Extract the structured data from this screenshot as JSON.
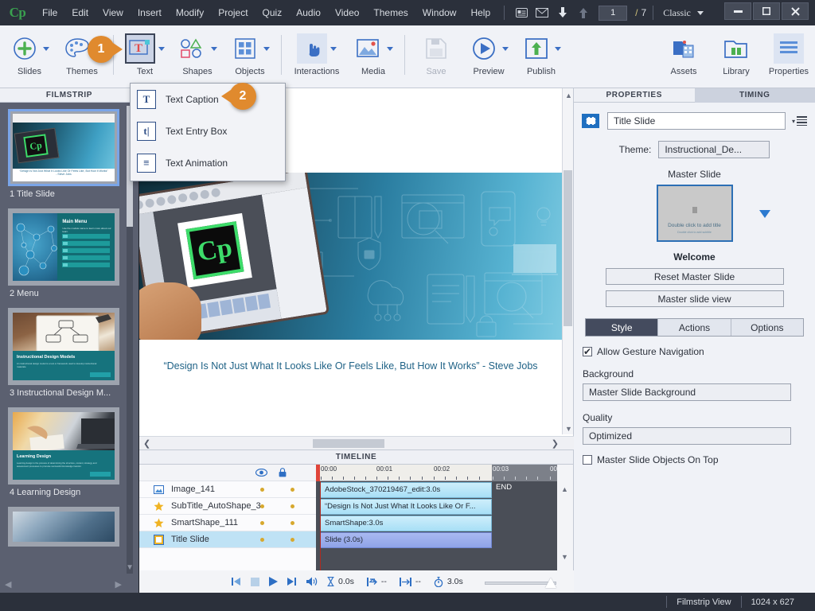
{
  "app": {
    "logo": "Cp",
    "title": "Adobe Captivate"
  },
  "menubar": {
    "items": [
      "File",
      "Edit",
      "View",
      "Insert",
      "Modify",
      "Project",
      "Quiz",
      "Audio",
      "Video",
      "Themes",
      "Window",
      "Help"
    ],
    "icons": [
      "notes-icon",
      "mail-icon",
      "download-arrow-icon",
      "upload-arrow-icon"
    ],
    "page_current": "1",
    "page_slash": "/",
    "page_total": "7",
    "workspace": "Classic",
    "window_buttons": {
      "minimize": "—",
      "maximize": "❐",
      "close": "✕"
    }
  },
  "toolbar": {
    "items": [
      {
        "label": "Slides",
        "icon": "add-slide-icon",
        "has_arrow": true,
        "state": "normal"
      },
      {
        "label": "Themes",
        "icon": "themes-palette-icon",
        "has_arrow": true,
        "state": "normal"
      },
      {
        "label": "Text",
        "icon": "text-tool-icon",
        "has_arrow": true,
        "state": "selected"
      },
      {
        "label": "Shapes",
        "icon": "shapes-icon",
        "has_arrow": true,
        "state": "normal"
      },
      {
        "label": "Objects",
        "icon": "objects-grid-icon",
        "has_arrow": true,
        "state": "normal"
      },
      {
        "label": "Interactions",
        "icon": "interactions-hand-icon",
        "has_arrow": true,
        "state": "highlight"
      },
      {
        "label": "Media",
        "icon": "media-image-icon",
        "has_arrow": true,
        "state": "normal"
      },
      {
        "label": "Save",
        "icon": "save-floppy-icon",
        "has_arrow": false,
        "state": "disabled"
      },
      {
        "label": "Preview",
        "icon": "preview-play-icon",
        "has_arrow": true,
        "state": "normal"
      },
      {
        "label": "Publish",
        "icon": "publish-upload-icon",
        "has_arrow": true,
        "state": "normal"
      },
      {
        "label": "Assets",
        "icon": "assets-icon",
        "has_arrow": false,
        "state": "normal"
      },
      {
        "label": "Library",
        "icon": "library-folder-icon",
        "has_arrow": false,
        "state": "normal"
      },
      {
        "label": "Properties",
        "icon": "properties-lines-icon",
        "has_arrow": false,
        "state": "highlight"
      }
    ]
  },
  "callouts": [
    {
      "number": "1",
      "target": "text-tool-button"
    },
    {
      "number": "2",
      "target": "text-caption-menu-item"
    }
  ],
  "text_menu": {
    "items": [
      {
        "label": "Text Caption",
        "icon": "text-caption-icon",
        "glyph": "T"
      },
      {
        "label": "Text Entry Box",
        "icon": "text-entry-box-icon",
        "glyph": "t|"
      },
      {
        "label": "Text Animation",
        "icon": "text-animation-icon",
        "glyph": "≡"
      }
    ]
  },
  "filmstrip": {
    "title": "FILMSTRIP",
    "slides": [
      {
        "caption": "1 Title Slide",
        "selected": true,
        "thumb": "title"
      },
      {
        "caption": "2 Menu",
        "selected": false,
        "thumb": "menu"
      },
      {
        "caption": "3 Instructional Design M...",
        "selected": false,
        "thumb": "idmodels"
      },
      {
        "caption": "4 Learning Design",
        "selected": false,
        "thumb": "learning"
      },
      {
        "caption": "",
        "selected": false,
        "thumb": "partial"
      }
    ],
    "menu_thumb": {
      "title": "Main Menu",
      "subtitle": "Use the module name to learn more about our team.",
      "bars": [
        "Instructional Design Models",
        "Learning Design",
        "Content",
        "Assessment",
        "Resources"
      ]
    },
    "id_thumb": {
      "title": "Instructional Design Models",
      "subtitle": "An instructional design model is a tool or framework used to develop instructional materials."
    },
    "learn_thumb": {
      "title": "Learning Design",
      "subtitle": "Learning design is the process of determining the structure, content, strategy and assessment processes to promote successful knowledge transfer."
    }
  },
  "slide": {
    "quote": "“Design Is Not Just What It Looks Like Or Feels Like, But How It Works” - Steve Jobs",
    "tablet_logo": "Cp"
  },
  "timeline": {
    "title": "TIMELINE",
    "col_eye": "eye-icon",
    "col_lock": "lock-icon",
    "rows": [
      {
        "name": "Image_141",
        "icon": "image-object-icon",
        "bar_label": "AdobeStock_370219467_edit:3.0s",
        "selected": false,
        "kind": "image"
      },
      {
        "name": "SubTitle_AutoShape_3",
        "icon": "smartshape-star-icon",
        "bar_label": "“Design Is Not Just What It Looks Like Or F...",
        "selected": false,
        "kind": "shape"
      },
      {
        "name": "SmartShape_111",
        "icon": "smartshape-star-icon",
        "bar_label": "SmartShape:3.0s",
        "selected": false,
        "kind": "shape"
      },
      {
        "name": "Title Slide",
        "icon": "slide-square-icon",
        "bar_label": "Slide (3.0s)",
        "selected": true,
        "kind": "slide"
      }
    ],
    "ruler_ticks": [
      "00:00",
      "00:01",
      "00:02",
      "00:03",
      "00:0"
    ],
    "end_marker": "END",
    "controls": {
      "rewind": "rewind-icon",
      "stop": "stop-icon",
      "play": "play-icon",
      "forward": "forward-icon",
      "audio": "audio-icon"
    },
    "readouts": [
      {
        "icon": "hourglass-icon",
        "value": "0.0s"
      },
      {
        "icon": "start-marker-icon",
        "value": "--"
      },
      {
        "icon": "end-marker-icon",
        "value": "--"
      },
      {
        "icon": "stopwatch-icon",
        "value": "3.0s"
      }
    ]
  },
  "properties": {
    "tabs": [
      {
        "label": "PROPERTIES",
        "active": false
      },
      {
        "label": "TIMING",
        "active": true
      }
    ],
    "slide_name": "Title Slide",
    "slide_name_placeholder": "Slide name",
    "menu_icon": "hamburger-menu-icon",
    "theme_label": "Theme:",
    "theme_value": "Instructional_De...",
    "master_slide_label": "Master Slide",
    "master_thumb_text": "Double click to add title",
    "master_thumb_subtext": "Double click to add subtitle",
    "master_name": "Welcome",
    "reset_master_button": "Reset Master Slide",
    "master_view_button": "Master slide view",
    "sub_tabs": [
      {
        "label": "Style",
        "active": true
      },
      {
        "label": "Actions",
        "active": false
      },
      {
        "label": "Options",
        "active": false
      }
    ],
    "gesture_checkbox": {
      "label": "Allow Gesture Navigation",
      "checked": true
    },
    "background_label": "Background",
    "background_value": "Master Slide Background",
    "quality_label": "Quality",
    "quality_value": "Optimized",
    "master_on_top_checkbox": {
      "label": "Master Slide Objects On Top",
      "checked": false
    }
  },
  "statusbar": {
    "view_mode": "Filmstrip View",
    "dimensions": "1024 x 627"
  },
  "colors": {
    "accent_blue": "#2e6fc4",
    "callout_orange": "#e08a2e",
    "dark_chrome": "#2b303b",
    "panel_bg": "#f0f2f7",
    "filmstrip_bg": "#5b6070",
    "timeline_track": "#4a4e57",
    "cp_green": "#3aa14f"
  }
}
